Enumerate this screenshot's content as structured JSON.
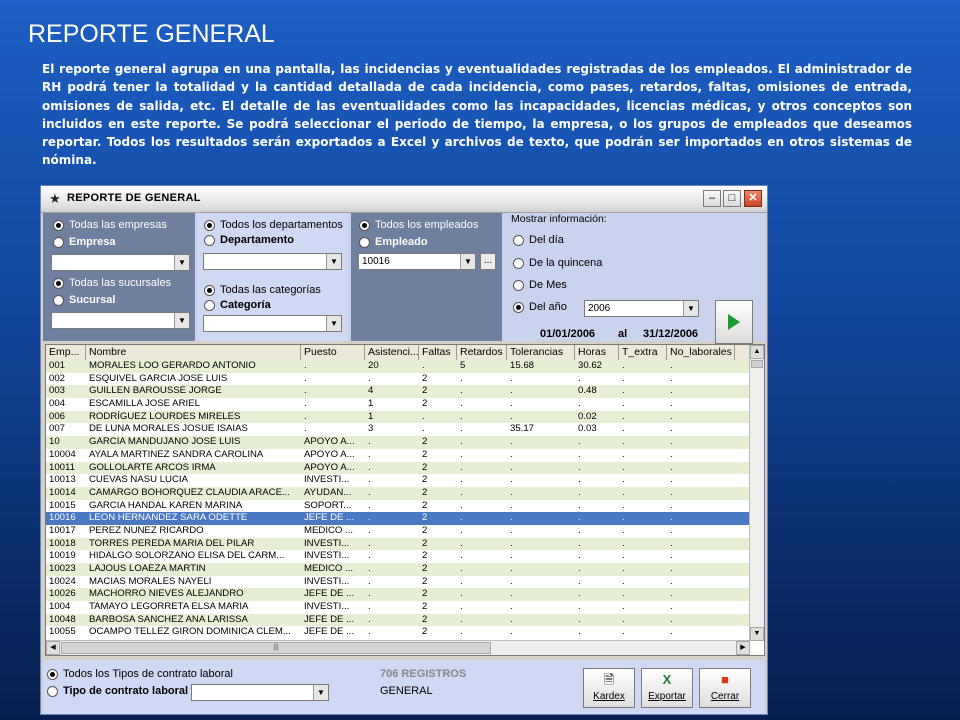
{
  "slide": {
    "title": "REPORTE GENERAL",
    "description": "El reporte general agrupa en una pantalla, las incidencias y eventualidades registradas de los empleados. El administrador de RH podrá tener la totalidad y la cantidad detallada de cada incidencia, como pases, retardos, faltas, omisiones de entrada, omisiones de salida, etc.   El detalle de las eventualidades como las incapacidades, licencias médicas, y otros conceptos son incluidos en este reporte. Se podrá seleccionar el periodo de tiempo, la empresa, o los grupos de empleados que deseamos reportar. Todos los resultados serán exportados a Excel y archivos de texto, que podrán ser importados en otros sistemas de nómina."
  },
  "window": {
    "title": "REPORTE DE GENERAL",
    "icons": {
      "app": "running-man-icon",
      "minimize": "minimize-icon",
      "maximize": "maximize-icon",
      "close": "close-icon"
    }
  },
  "filters": {
    "empresa": {
      "all_label": "Todas las empresas",
      "one_label": "Empresa",
      "selected": "all",
      "combo_value": ""
    },
    "sucursal": {
      "all_label": "Todas las sucursales",
      "one_label": "Sucursal",
      "selected": "all",
      "combo_value": ""
    },
    "departamento": {
      "all_label": "Todos los departamentos",
      "one_label": "Departamento",
      "selected": "all",
      "combo_value": ""
    },
    "categoria": {
      "all_label": "Todas las categorías",
      "one_label": "Categoría",
      "selected": "all",
      "combo_value": ""
    },
    "empleado": {
      "all_label": "Todos los empleados",
      "one_label": "Empleado",
      "selected": "all",
      "combo_value": "10016",
      "browse_label": "..."
    }
  },
  "period": {
    "title": "Mostrar información:",
    "options": [
      "Del día",
      "De la quincena",
      "De Mes",
      "Del año"
    ],
    "selected": "Del año",
    "year_value": "2006",
    "date_from": "01/01/2006",
    "date_sep": "al",
    "date_to": "31/12/2006"
  },
  "grid": {
    "columns": [
      "Emp...",
      "Nombre",
      "Puesto",
      "Asistenci...",
      "Faltas",
      "Retardos",
      "Tolerancias",
      "Horas",
      "T_extra",
      "No_laborales"
    ],
    "rows": [
      [
        "001",
        "MORALES LOO GERARDO ANTONIO",
        ".",
        "20",
        ".",
        "5",
        "15.68",
        "30.62",
        ".",
        "."
      ],
      [
        "002",
        "ESQUIVEL GARCIA JOSE LUIS",
        ".",
        ".",
        "2",
        ".",
        ".",
        ".",
        ".",
        "."
      ],
      [
        "003",
        "GUILLEN BAROUSSE JORGE",
        ".",
        "4",
        "2",
        ".",
        ".",
        "0.48",
        ".",
        "."
      ],
      [
        "004",
        "ESCAMILLA  JOSE ARIEL",
        ".",
        "1",
        "2",
        ".",
        ".",
        ".",
        ".",
        "."
      ],
      [
        "006",
        "RODRÍGUEZ  LOURDES MIRELES",
        ".",
        "1",
        ".",
        ".",
        ".",
        "0.02",
        ".",
        "."
      ],
      [
        "007",
        "DE LUNA  MORALES JOSUE ISAIAS",
        ".",
        "3",
        ".",
        ".",
        "35.17",
        "0.03",
        ".",
        "."
      ],
      [
        "10",
        "GARCIA MANDUJANO JOSE LUIS",
        "APOYO A...",
        ".",
        "2",
        ".",
        ".",
        ".",
        ".",
        "."
      ],
      [
        "10004",
        "AYALA MARTINEZ SANDRA CAROLINA",
        "APOYO A...",
        ".",
        "2",
        ".",
        ".",
        ".",
        ".",
        "."
      ],
      [
        "10011",
        "GOLLOLARTE ARCOS IRMA",
        "APOYO A...",
        ".",
        "2",
        ".",
        ".",
        ".",
        ".",
        "."
      ],
      [
        "10013",
        "CUEVAS NASU LUCIA",
        "INVESTI...",
        ".",
        "2",
        ".",
        ".",
        ".",
        ".",
        "."
      ],
      [
        "10014",
        "CAMARGO BOHORQUEZ CLAUDIA ARACE...",
        "AYUDAN...",
        ".",
        "2",
        ".",
        ".",
        ".",
        ".",
        "."
      ],
      [
        "10015",
        "GARCIA HANDAL KAREN MARINA",
        "SOPORT...",
        ".",
        "2",
        ".",
        ".",
        ".",
        ".",
        "."
      ],
      [
        "10016",
        "LEON HERNANDEZ SARA ODETTE",
        "JEFE DE ...",
        ".",
        "2",
        ".",
        ".",
        ".",
        ".",
        "."
      ],
      [
        "10017",
        "PEREZ NUNEZ RICARDO",
        "MEDICO ...",
        ".",
        "2",
        ".",
        ".",
        ".",
        ".",
        "."
      ],
      [
        "10018",
        "TORRES PEREDA MARIA DEL PILAR",
        "INVESTI...",
        ".",
        "2",
        ".",
        ".",
        ".",
        ".",
        "."
      ],
      [
        "10019",
        "HIDALGO SOLORZANO ELISA DEL CARM...",
        "INVESTI...",
        ".",
        "2",
        ".",
        ".",
        ".",
        ".",
        "."
      ],
      [
        "10023",
        "LAJOUS LOAEZA MARTIN",
        "MEDICO ...",
        ".",
        "2",
        ".",
        ".",
        ".",
        ".",
        "."
      ],
      [
        "10024",
        "MACIAS MORALES NAYELI",
        "INVESTI...",
        ".",
        "2",
        ".",
        ".",
        ".",
        ".",
        "."
      ],
      [
        "10026",
        "MACHORRO NIEVES ALEJANDRO",
        "JEFE DE ...",
        ".",
        "2",
        ".",
        ".",
        ".",
        ".",
        "."
      ],
      [
        "1004",
        "TAMAYO LEGORRETA ELSA MARIA",
        "INVESTI...",
        ".",
        "2",
        ".",
        ".",
        ".",
        ".",
        "."
      ],
      [
        "10048",
        "BARBOSA SANCHEZ ANA LARISSA",
        "JEFE DE ...",
        ".",
        "2",
        ".",
        ".",
        ".",
        ".",
        "."
      ],
      [
        "10055",
        "OCAMPO TELLEZ GIRON DOMINICA CLEM...",
        "JEFE DE ...",
        ".",
        "2",
        ".",
        ".",
        ".",
        ".",
        "."
      ]
    ],
    "selected_row": 12
  },
  "bottom": {
    "contract_all_label": "Todos los Tipos de contrato laboral",
    "contract_one_label": "Tipo de contrato laboral",
    "contract_selected": "all",
    "contract_combo_value": "",
    "record_count": "706 REGISTROS",
    "group_value": "GENERAL",
    "buttons": {
      "kardex": "Kardex",
      "exportar": "Exportar",
      "cerrar": "Cerrar"
    }
  },
  "colors": {
    "selected_row": "#4a79c4",
    "alt_row": "#e6efd3",
    "filter_panel": "#6e7f9f",
    "export_icon": "#1e7a3a",
    "close_icon": "#d9361a"
  }
}
